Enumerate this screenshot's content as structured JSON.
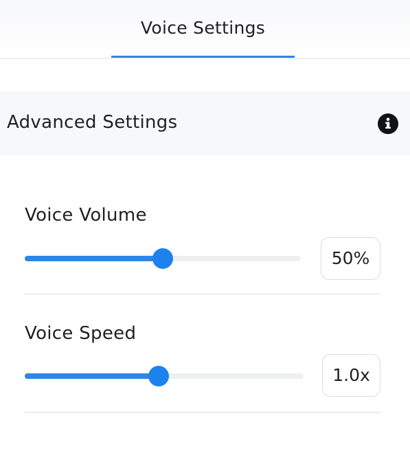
{
  "tabs": [
    {
      "label": "Voice Settings",
      "active": true
    }
  ],
  "section": {
    "title": "Advanced Settings",
    "icon": "info-icon"
  },
  "settings": {
    "volume": {
      "label": "Voice Volume",
      "value_text": "50%",
      "level": 0.5
    },
    "speed": {
      "label": "Voice Speed",
      "value_text": "1.0x",
      "level": 0.48
    }
  },
  "colors": {
    "accent": "#2f86e6",
    "thumb": "#1d82ee",
    "track": "#eeeff1",
    "section_bg": "#f6f8fa",
    "divider": "#d9dce1"
  }
}
